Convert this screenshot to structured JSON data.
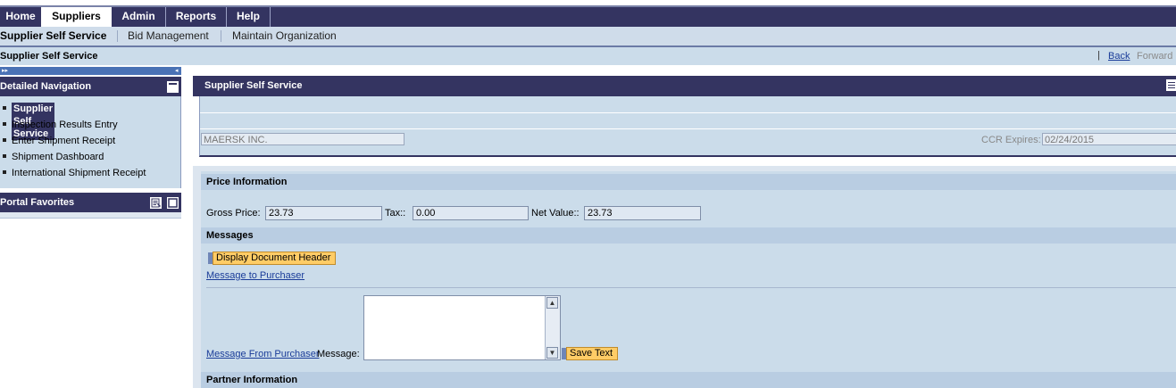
{
  "top_nav": {
    "tabs": [
      {
        "label": "Home",
        "active": false
      },
      {
        "label": "Suppliers",
        "active": true
      },
      {
        "label": "Admin",
        "active": false
      },
      {
        "label": "Reports",
        "active": false
      },
      {
        "label": "Help",
        "active": false
      }
    ]
  },
  "sub_nav": {
    "items": [
      {
        "label": "Supplier Self Service",
        "active": true
      },
      {
        "label": "Bid Management",
        "active": false
      },
      {
        "label": "Maintain Organization",
        "active": false
      }
    ]
  },
  "page": {
    "title": "Supplier Self Service",
    "history_separator": "|",
    "back": "Back",
    "forward": "Forward"
  },
  "left_nav": {
    "detailed_title": "Detailed Navigation",
    "items": [
      {
        "label": "Supplier Self Service",
        "selected": true
      },
      {
        "label": "Inspection Results Entry",
        "selected": false
      },
      {
        "label": "Enter Shipment Receipt",
        "selected": false
      },
      {
        "label": "Shipment Dashboard",
        "selected": false
      },
      {
        "label": "International Shipment Receipt",
        "selected": false
      }
    ],
    "favorites_title": "Portal Favorites"
  },
  "content_header": {
    "title": "Supplier Self Service",
    "company": "MAERSK INC.",
    "ccr_label": "CCR Expires:",
    "ccr_value": "02/24/2015"
  },
  "price": {
    "section_title": "Price Information",
    "gross_label": "Gross Price:",
    "gross_value": "23.73",
    "tax_label": "Tax::",
    "tax_value": "0.00",
    "net_label": "Net Value::",
    "net_value": "23.73"
  },
  "messages": {
    "section_title": "Messages",
    "display_header_button": "Display Document Header",
    "message_to_purchaser": "Message to Purchaser",
    "message_from_purchaser": "Message From Purchaser",
    "message_label": "Message:",
    "message_value": "",
    "save_text_button": "Save Text"
  },
  "partner": {
    "section_title": "Partner Information"
  },
  "colors": {
    "nav_dark": "#343461",
    "panel_light": "#cbdcea",
    "button_yellow": "#ffcc66",
    "link_blue": "#1a3c99"
  }
}
